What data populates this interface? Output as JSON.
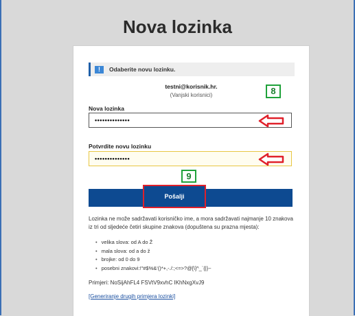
{
  "page": {
    "title": "Nova lozinka"
  },
  "info": {
    "text": "Odaberite novu lozinku.",
    "icon": "message-icon"
  },
  "user": {
    "email": "testni@korisnik.hr.",
    "type": "(Vanjski korisnici)"
  },
  "badges": {
    "first": "8",
    "second": "9"
  },
  "fields": {
    "new_password": {
      "label": "Nova lozinka",
      "value": "••••••••••••••"
    },
    "confirm_password": {
      "label": "Potvrdite novu lozinku",
      "value": "••••••••••••••"
    }
  },
  "submit": {
    "label": "Pošalji"
  },
  "rules": {
    "intro": "Lozinka ne može sadržavati korisničko ime, a mora sadržavati najmanje 10 znakova iz tri od sljedeće četiri skupine znakova (dopuštena su prazna mjesta):",
    "items": [
      "velika slova: od A do Ž",
      "mala slova: od a do ž",
      "brojke: od 0 do 9",
      "posebni znakovi:!\"#$%&'()*+,-./:;<=>?@[\\]^_`{|}~"
    ]
  },
  "examples": "Primjeri: NoSijAhFL4 FSVtV9xvhC IKhNxgXvJ9",
  "generate_link": "[Generiranje drugih primjera lozinki]",
  "colors": {
    "accent": "#0d4a91",
    "highlight": "#e0202a",
    "badge": "#1fa23a"
  }
}
